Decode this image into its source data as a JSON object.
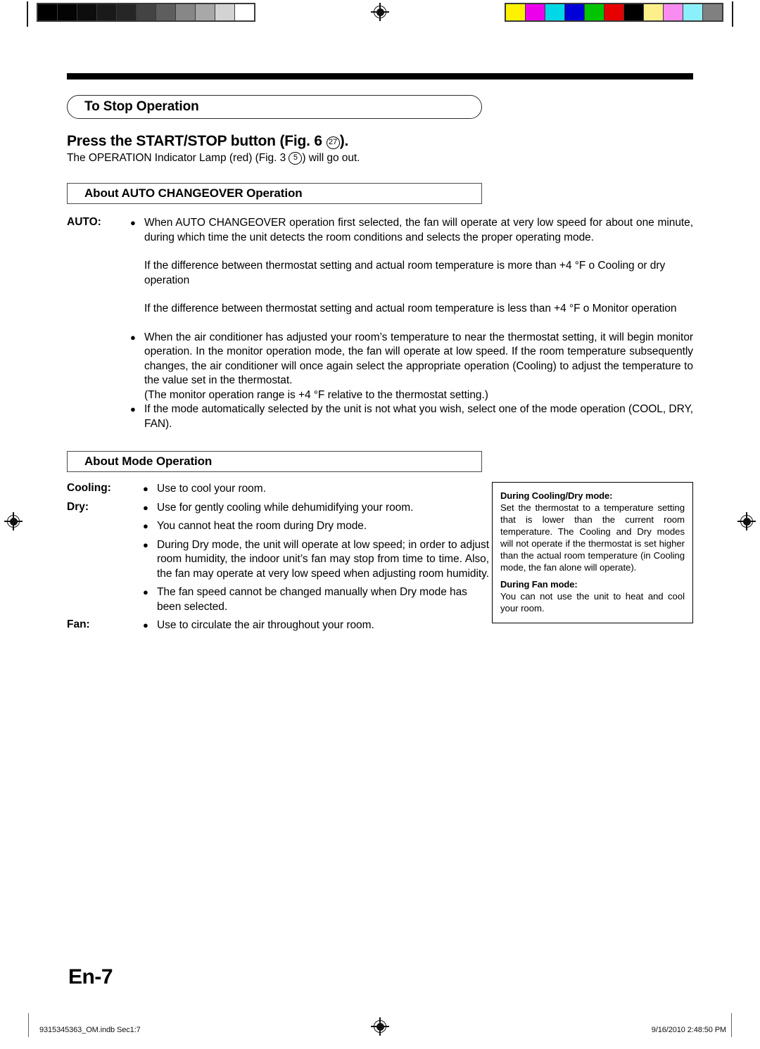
{
  "print_marks": {
    "gray_wedge_label": "grayscale-step-wedge",
    "gray_patches": [
      "#000000",
      "#040404",
      "#0d0d0d",
      "#1a1a1a",
      "#262626",
      "#434343",
      "#5e5e5e",
      "#878787",
      "#a8a8a8",
      "#d3d3d3",
      "#ffffff"
    ],
    "color_wedge_label": "process-color-bar",
    "color_patches": [
      "#fff200",
      "#ec00ec",
      "#00d8e8",
      "#0000d8",
      "#00c400",
      "#e60000",
      "#000000",
      "#fdf08a",
      "#f98cf0",
      "#8cf0fb",
      "#808080"
    ],
    "registration_mark_label": "registration-target"
  },
  "document": {
    "section_stop": {
      "heading": "To Stop Operation",
      "press_line_prefix": "Press the START/STOP button  (Fig. 6 ",
      "press_line_circled": "27",
      "press_line_suffix": ").",
      "sub_prefix": "The OPERATION Indicator Lamp (red) (Fig. 3 ",
      "sub_circled": "5",
      "sub_suffix": ") will go out."
    },
    "section_auto": {
      "heading": "About AUTO CHANGEOVER Operation",
      "term": "AUTO:",
      "items": [
        {
          "bullet": true,
          "text": "When AUTO CHANGEOVER operation first selected, the fan will operate at very low speed for about one minute, during which time the unit detects the room conditions and selects the proper operating mode."
        },
        {
          "bullet": false,
          "text": "If the difference between thermostat setting and actual room temperature is more than +4 °F  o  Cooling or dry operation"
        },
        {
          "bullet": false,
          "text": "If the difference between thermostat setting and actual room temperature is less than +4 °F  o  Monitor operation"
        },
        {
          "bullet": true,
          "text": "When the air conditioner has adjusted your room’s temperature to near the thermostat setting, it will begin monitor operation. In the monitor operation mode, the fan will operate at low speed. If the room temperature subsequently changes, the air conditioner will once again select the appropriate operation (Cooling) to adjust the temperature to the value set in the thermostat."
        },
        {
          "bullet": false,
          "text": "(The monitor operation range is +4 °F relative to the thermostat setting.)"
        },
        {
          "bullet": true,
          "text": "If the mode automatically selected by the unit is not what you wish, select one of the mode operation (COOL, DRY, FAN)."
        }
      ]
    },
    "section_mode": {
      "heading": "About Mode Operation",
      "rows": [
        {
          "term": "Cooling:",
          "text": "Use to cool your room."
        },
        {
          "term": "Dry:",
          "text": "Use for gently cooling while dehumidifying your room."
        },
        {
          "term": "",
          "text": "You cannot heat the room during Dry mode."
        },
        {
          "term": "",
          "text": "During Dry mode, the unit will operate at low speed; in order to adjust room humidity, the indoor unit’s fan may stop from time to time. Also, the fan may operate at very low speed when adjusting room humidity."
        },
        {
          "term": "",
          "text": "The fan speed cannot be changed manually when Dry mode has been selected."
        },
        {
          "term": "Fan:",
          "text": "Use to circulate the air throughout your room."
        }
      ]
    },
    "note_box": {
      "title_1": "During Cooling/Dry mode:",
      "text_1": "Set the thermostat to a temperature setting that is lower than the current room temperature. The Cooling and Dry modes will not operate if the thermostat is set higher than the actual room temperature (in Cooling mode, the fan alone will operate).",
      "title_2": "During Fan mode:",
      "text_2": "You can not use the unit to heat and cool your room."
    },
    "page_number": "En-7"
  },
  "footer": {
    "left": "9315345363_OM.indb   Sec1:7",
    "right": "9/16/2010   2:48:50 PM"
  }
}
